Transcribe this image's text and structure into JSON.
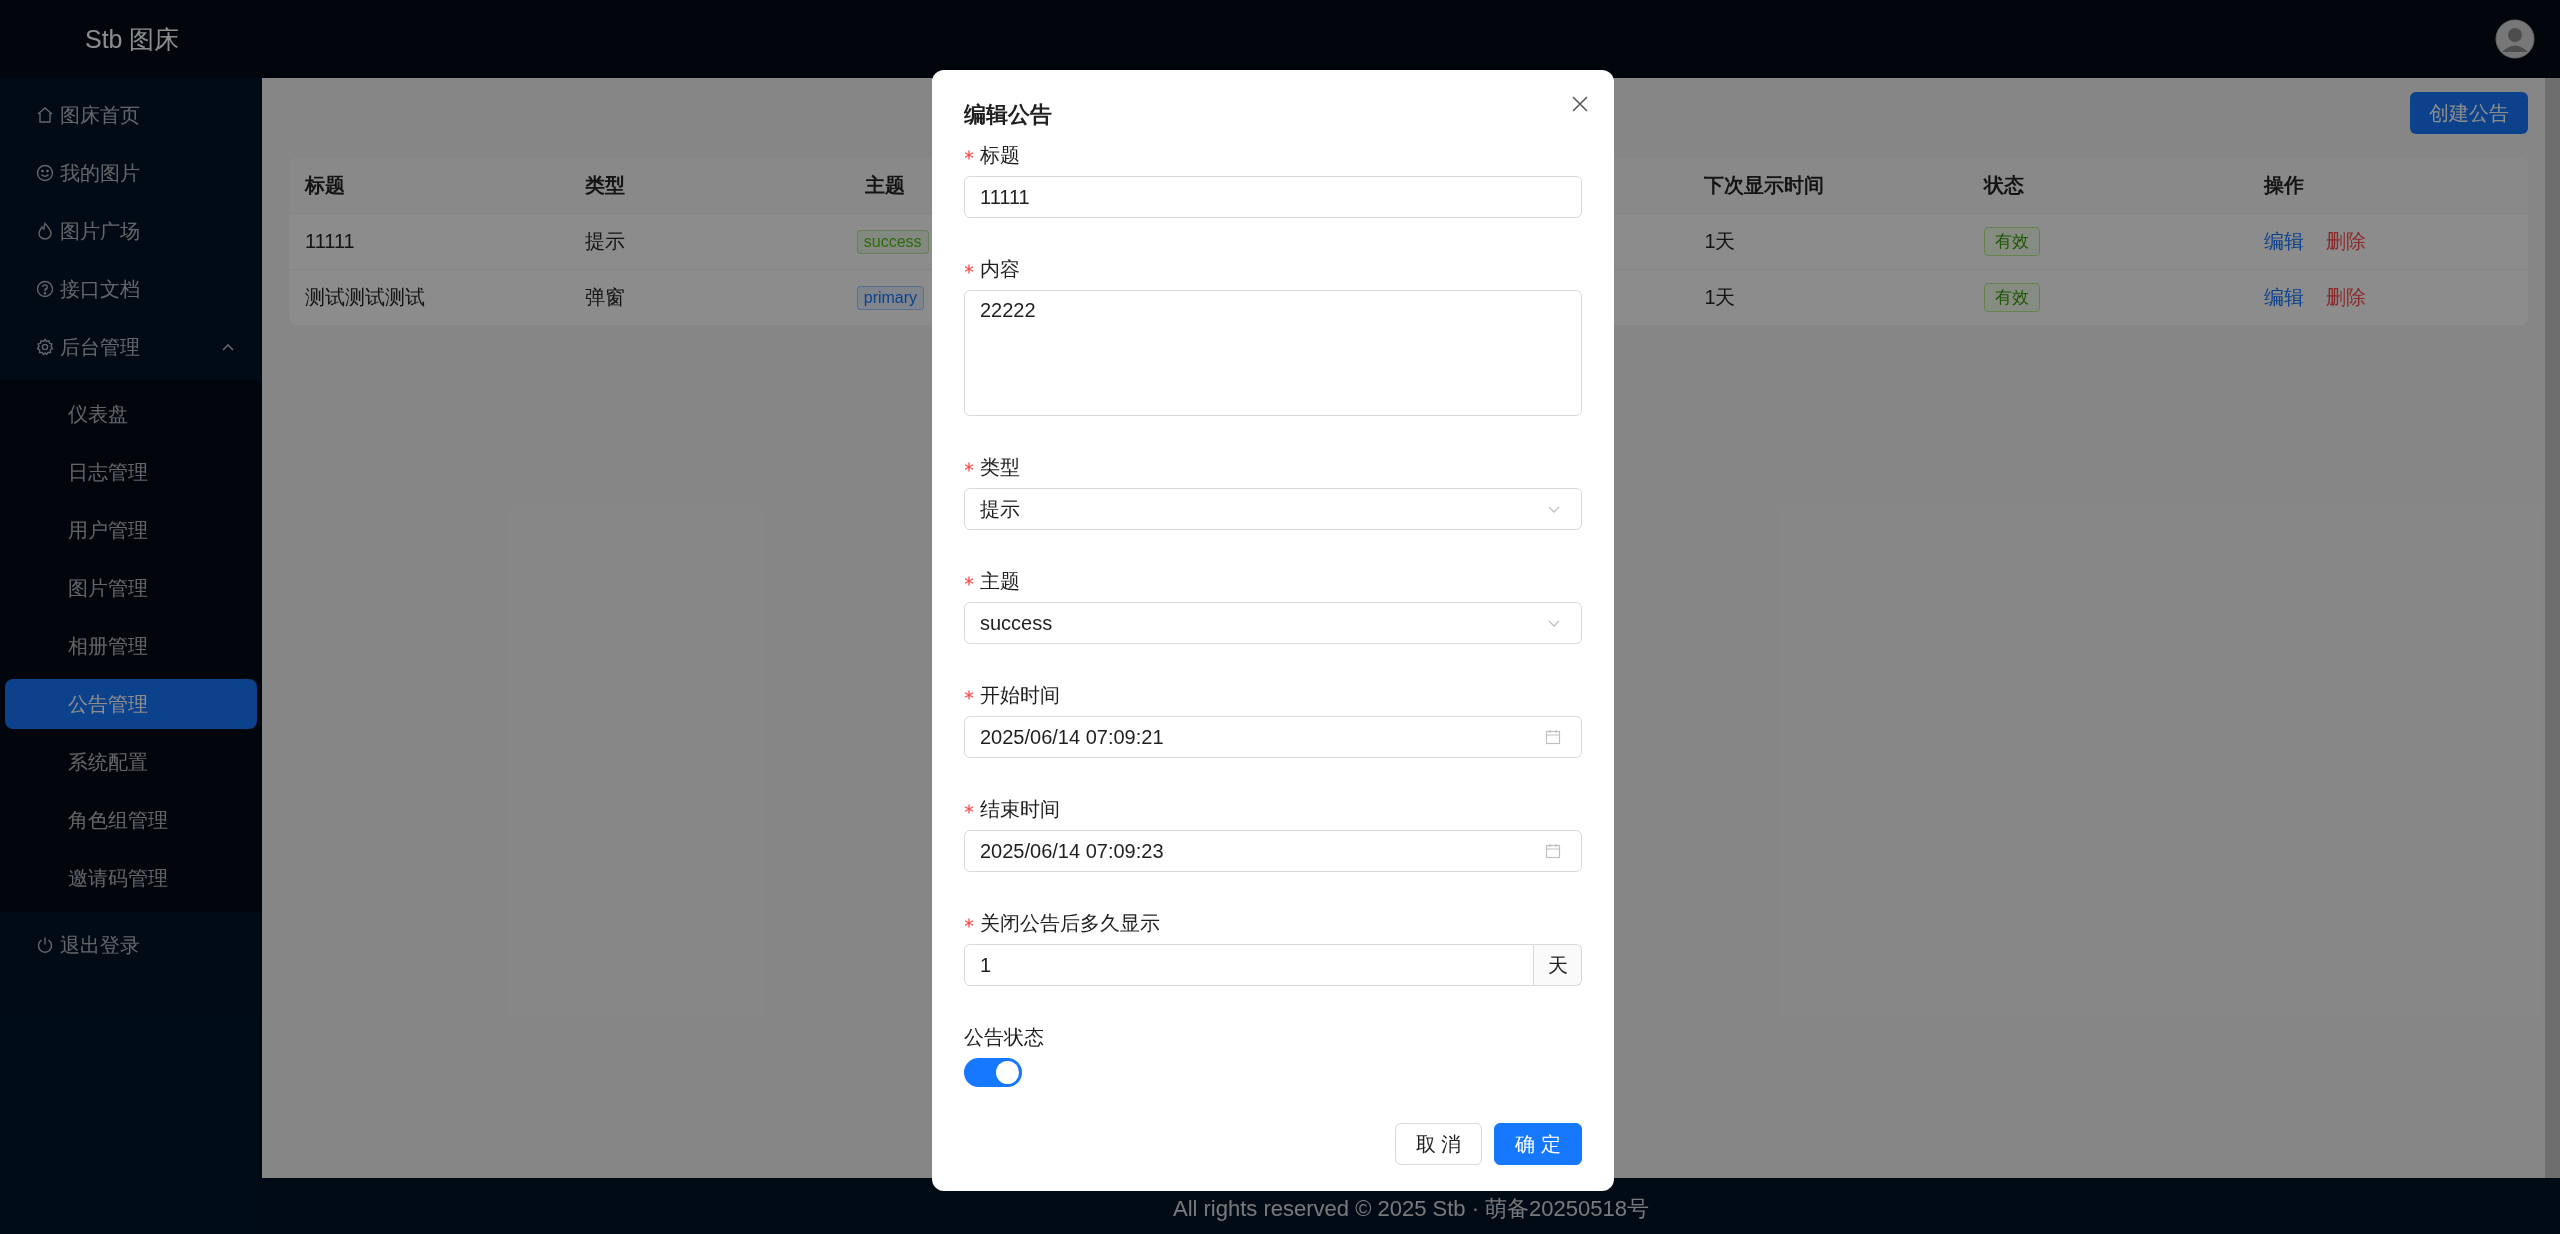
{
  "app": {
    "logo": "Stb 图床"
  },
  "sidebar": {
    "items": [
      {
        "label": "图床首页",
        "selected": false
      },
      {
        "label": "我的图片",
        "selected": false
      },
      {
        "label": "图片广场",
        "selected": false
      },
      {
        "label": "接口文档",
        "selected": false
      },
      {
        "label": "后台管理",
        "selected": false,
        "expanded": true,
        "children": [
          {
            "label": "仪表盘",
            "selected": false
          },
          {
            "label": "日志管理",
            "selected": false
          },
          {
            "label": "用户管理",
            "selected": false
          },
          {
            "label": "图片管理",
            "selected": false
          },
          {
            "label": "相册管理",
            "selected": false
          },
          {
            "label": "公告管理",
            "selected": true
          },
          {
            "label": "系统配置",
            "selected": false
          },
          {
            "label": "角色组管理",
            "selected": false
          },
          {
            "label": "邀请码管理",
            "selected": false
          }
        ]
      },
      {
        "label": "退出登录",
        "selected": false
      }
    ]
  },
  "toolbar": {
    "create_button": "创建公告"
  },
  "table": {
    "columns": [
      "标题",
      "类型",
      "主题",
      "下次显示时间",
      "状态",
      "操作"
    ],
    "rows": [
      {
        "title": "11111",
        "type": "提示",
        "theme": {
          "text": "success",
          "kind": "success"
        },
        "next_show": "1天",
        "status": "有效",
        "actions": [
          "编辑",
          "删除"
        ]
      },
      {
        "title": "测试测试测试",
        "type": "弹窗",
        "theme": {
          "text": "primary",
          "kind": "primary"
        },
        "next_show": "1天",
        "status": "有效",
        "actions": [
          "编辑",
          "删除"
        ]
      }
    ]
  },
  "dialog": {
    "title": "编辑公告",
    "fields": [
      {
        "kind": "text",
        "label": "标题",
        "required": true,
        "value": "11111"
      },
      {
        "kind": "textarea",
        "label": "内容",
        "required": true,
        "value": "22222"
      },
      {
        "kind": "select",
        "label": "类型",
        "required": true,
        "value": "提示"
      },
      {
        "kind": "select",
        "label": "主题",
        "required": true,
        "value": "success"
      },
      {
        "kind": "date",
        "label": "开始时间",
        "required": true,
        "value": "2025/06/14 07:09:21"
      },
      {
        "kind": "date",
        "label": "结束时间",
        "required": true,
        "value": "2025/06/14 07:09:23"
      },
      {
        "kind": "number",
        "label": "关闭公告后多久显示",
        "required": true,
        "value": "1",
        "suffix": "天"
      },
      {
        "kind": "switch",
        "label": "公告状态",
        "required": false,
        "on": true
      }
    ],
    "buttons": [
      {
        "label": "取 消",
        "kind": "default"
      },
      {
        "label": "确 定",
        "kind": "primary"
      }
    ]
  },
  "footer": {
    "text": "All rights reserved © 2025 Stb · 萌备20250518号"
  }
}
